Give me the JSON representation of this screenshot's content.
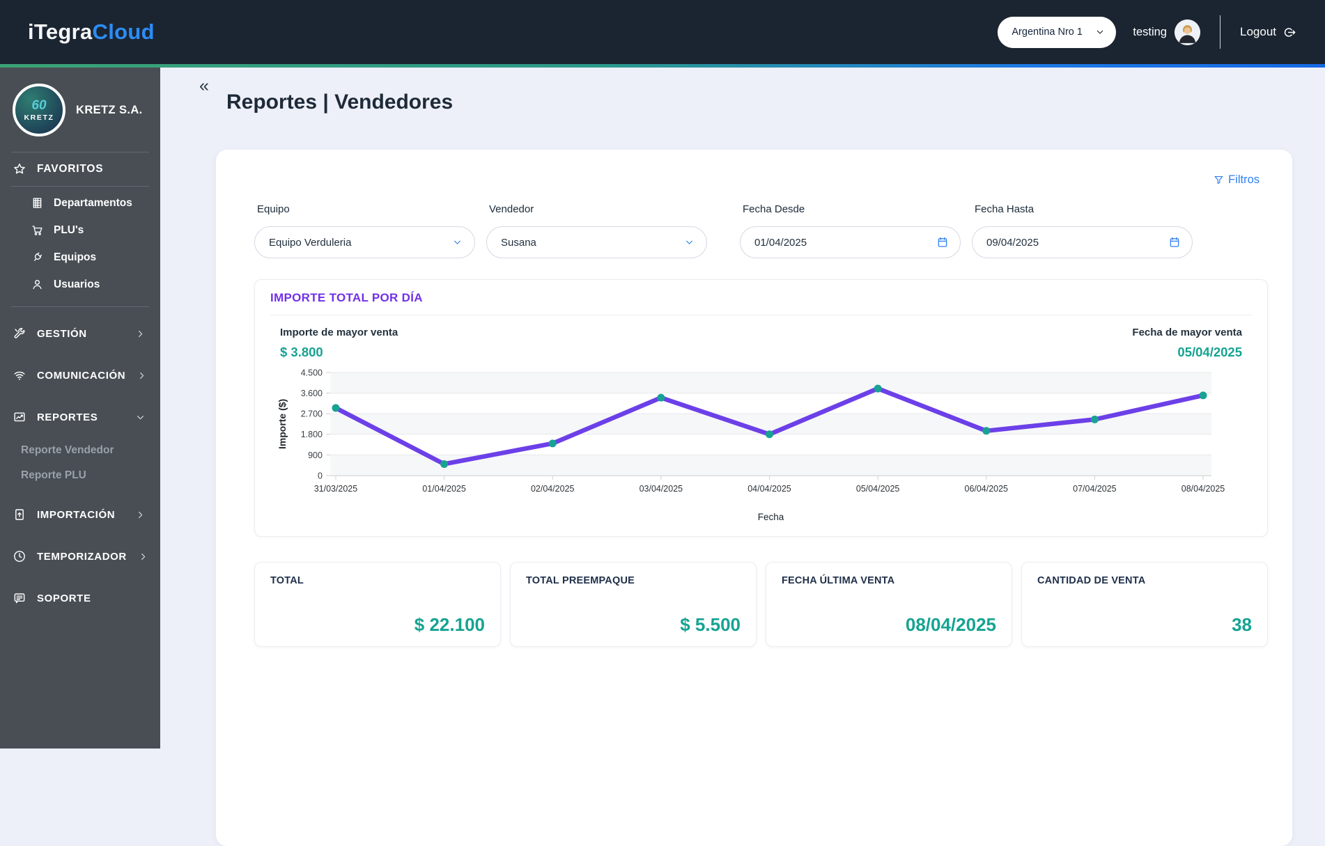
{
  "header": {
    "logo_part1": "iTegra",
    "logo_part2": "Cloud",
    "store_selector": {
      "value": "Argentina Nro 1",
      "icon": "chevron-down-icon"
    },
    "username": "testing",
    "logout_label": "Logout"
  },
  "sidebar": {
    "company": "KRETZ S.A.",
    "avatar_line1": "60",
    "avatar_line2": "KRETZ",
    "favorites_label": "FAVORITOS",
    "favorites_icon": "star-icon",
    "favorites": [
      {
        "label": "Departamentos",
        "icon": "departments-icon"
      },
      {
        "label": "PLU's",
        "icon": "cart-icon"
      },
      {
        "label": "Equipos",
        "icon": "plug-icon"
      },
      {
        "label": "Usuarios",
        "icon": "user-icon"
      }
    ],
    "sections": [
      {
        "label": "GESTIÓN",
        "icon": "tools-icon",
        "chevron": "right"
      },
      {
        "label": "COMUNICACIÓN",
        "icon": "wifi-icon",
        "chevron": "right"
      },
      {
        "label": "REPORTES",
        "icon": "report-chart-icon",
        "chevron": "down",
        "children": [
          "Reporte Vendedor",
          "Reporte PLU"
        ]
      },
      {
        "label": "IMPORTACIÓN",
        "icon": "import-document-icon",
        "chevron": "right"
      },
      {
        "label": "TEMPORIZADOR",
        "icon": "clock-icon",
        "chevron": "right"
      },
      {
        "label": "SOPORTE",
        "icon": "support-icon",
        "chevron": "none"
      }
    ]
  },
  "page": {
    "collapse_icon": "«",
    "title_bold": "Reportes |",
    "title_light": "Vendedores"
  },
  "filters": {
    "filters_link": "Filtros",
    "equipo": {
      "label": "Equipo",
      "value": "Equipo Verduleria"
    },
    "vendedor": {
      "label": "Vendedor",
      "value": "Susana"
    },
    "fecha_desde": {
      "label": "Fecha Desde",
      "value": "01/04/2025"
    },
    "fecha_hasta": {
      "label": "Fecha Hasta",
      "value": "09/04/2025"
    }
  },
  "chart_card": {
    "title": "IMPORTE TOTAL POR DÍA",
    "max_sale_label": "Importe de mayor venta",
    "max_sale_value": "$ 3.800",
    "max_date_label": "Fecha de mayor venta",
    "max_date_value": "05/04/2025"
  },
  "chart_data": {
    "type": "line",
    "x": [
      "31/03/2025",
      "01/04/2025",
      "02/04/2025",
      "03/04/2025",
      "04/04/2025",
      "05/04/2025",
      "06/04/2025",
      "07/04/2025",
      "08/04/2025"
    ],
    "values": [
      2950,
      500,
      1400,
      3400,
      1800,
      3800,
      1950,
      2450,
      3500
    ],
    "xlabel": "Fecha",
    "ylabel": "Importe ($)",
    "ylim": [
      0,
      4500
    ],
    "yticks": [
      0,
      900,
      1800,
      2700,
      3600,
      4500
    ],
    "grid": true,
    "legend": "none",
    "line_color": "#6c40e8",
    "point_color": "#17a293",
    "band_color": "#f6f7f8"
  },
  "stats": [
    {
      "label": "TOTAL",
      "value": "$ 22.100"
    },
    {
      "label": "TOTAL PREEMPAQUE",
      "value": "$ 5.500"
    },
    {
      "label": "FECHA ÚLTIMA VENTA",
      "value": "08/04/2025"
    },
    {
      "label": "CANTIDAD DE VENTA",
      "value": "38"
    }
  ],
  "colors": {
    "header_bg": "#1b2531",
    "sidebar_bg": "#484e54",
    "page_bg": "#edf0f8",
    "accent_green": "#3ba275",
    "accent_blue": "#1668e6",
    "link_blue": "#2e7ff2",
    "purple": "#7230e8",
    "teal": "#16a392"
  }
}
